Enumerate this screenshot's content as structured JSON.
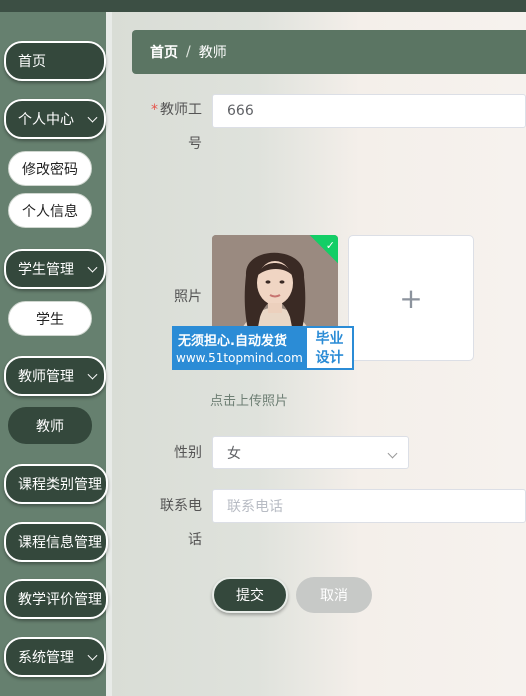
{
  "sidebar": {
    "items": [
      {
        "label": "首页"
      },
      {
        "label": "个人中心"
      },
      {
        "label": "修改密码"
      },
      {
        "label": "个人信息"
      },
      {
        "label": "学生管理"
      },
      {
        "label": "学生"
      },
      {
        "label": "教师管理"
      },
      {
        "label": "教师"
      },
      {
        "label": "课程类别管理"
      },
      {
        "label": "课程信息管理"
      },
      {
        "label": "教学评价管理"
      },
      {
        "label": "系统管理"
      }
    ]
  },
  "breadcrumb": {
    "home": "首页",
    "separator": "/",
    "current": "教师"
  },
  "form": {
    "teacher_no": {
      "label_line1": "教师工",
      "label_line2": "号",
      "required_mark": "*",
      "value": "666"
    },
    "photo": {
      "label": "照片",
      "add_glyph": "+",
      "hint": "点击上传照片",
      "uploaded_check": "✓"
    },
    "gender": {
      "label": "性别",
      "value": "女"
    },
    "phone": {
      "label_line1": "联系电",
      "label_line2": "话",
      "placeholder": "联系电话"
    },
    "submit": "提交",
    "cancel": "取消"
  },
  "watermark": {
    "line1": "无须担心.自动发货",
    "line2": "www.51topmind.com",
    "side_line1": "毕业",
    "side_line2": "设计"
  },
  "colors": {
    "sidebar": "#66806f",
    "dark_button": "#34483c",
    "breadcrumb": "#5b7563",
    "required": "#e5534b",
    "watermark_blue": "#2b8cd6"
  }
}
